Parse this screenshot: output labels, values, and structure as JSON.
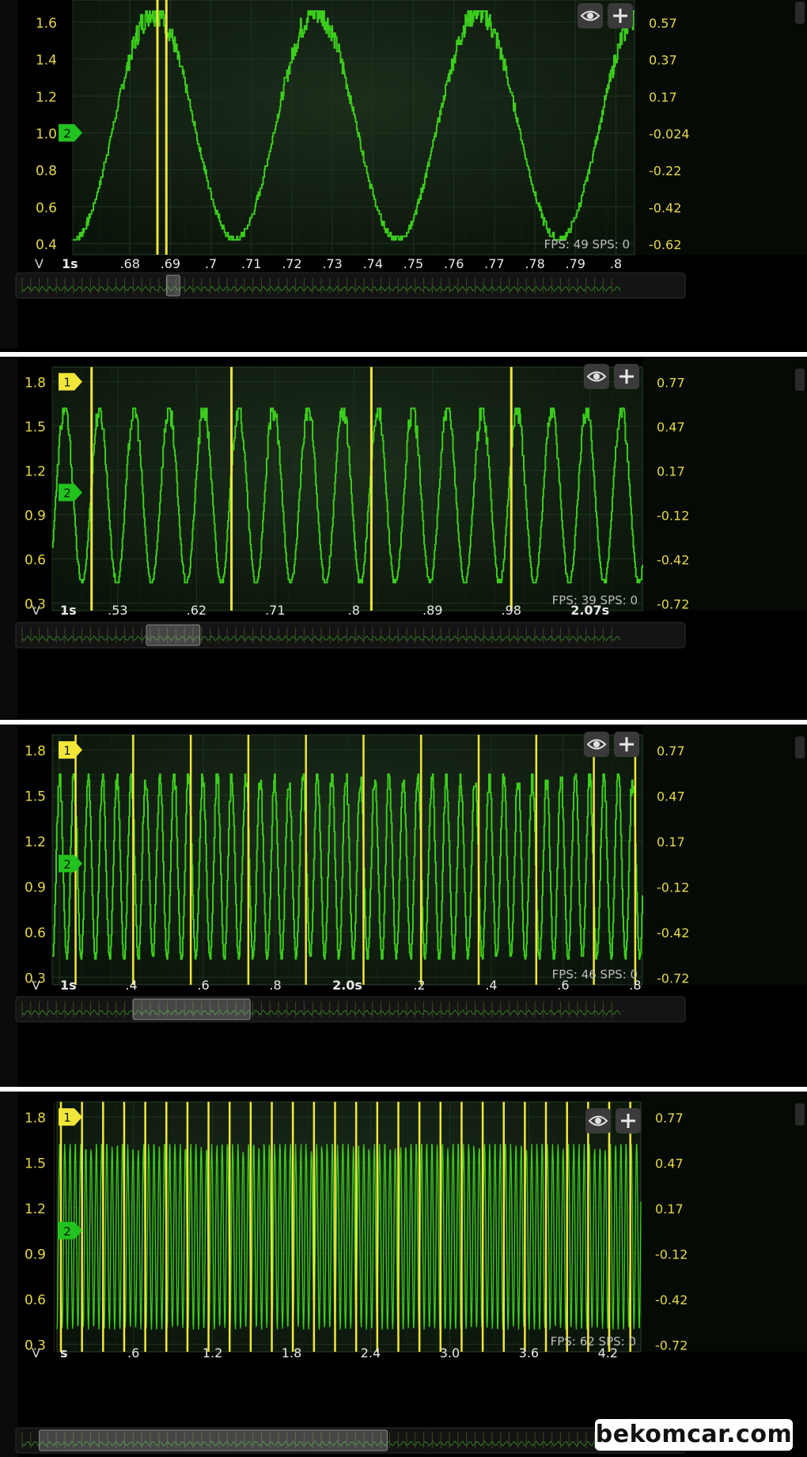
{
  "colors": {
    "trace": "#3ccd1c",
    "cursor": "#f2e63a",
    "label": "#e6d84a",
    "grid": "#1f3320",
    "plot_bg": "#0e1a0e",
    "marker1": "#f2e63a",
    "marker2": "#22c21f"
  },
  "watermark": "bekomcar.com",
  "chart_data": [
    {
      "type": "line",
      "unit_label": "V",
      "x_ticks": [
        {
          "x": 0.6659,
          "label": "1s",
          "bold": true
        },
        {
          "x": 0.68,
          "label": ".68"
        },
        {
          "x": 0.69,
          "label": ".69"
        },
        {
          "x": 0.7,
          "label": ".7"
        },
        {
          "x": 0.71,
          "label": ".71"
        },
        {
          "x": 0.72,
          "label": ".72"
        },
        {
          "x": 0.73,
          "label": ".73"
        },
        {
          "x": 0.74,
          "label": ".74"
        },
        {
          "x": 0.75,
          "label": ".75"
        },
        {
          "x": 0.76,
          "label": ".76"
        },
        {
          "x": 0.77,
          "label": ".77"
        },
        {
          "x": 0.78,
          "label": ".78"
        },
        {
          "x": 0.79,
          "label": ".79"
        },
        {
          "x": 0.8,
          "label": ".8"
        }
      ],
      "xlim": [
        0.6659,
        0.8046
      ],
      "ylim": [
        0.34,
        1.72
      ],
      "y_ticks": [
        0.4,
        0.6,
        0.8,
        1.0,
        1.2,
        1.4,
        1.6
      ],
      "y_tick_labels": [
        "0.4",
        "0.6",
        "0.8",
        "1.0",
        "1.2",
        "1.4",
        "1.6"
      ],
      "y2_tick_labels": [
        "-0.62",
        "-0.42",
        "-0.22",
        "-0.024",
        "0.17",
        "0.37",
        "0.57"
      ],
      "markers": [
        {
          "label": "2",
          "y": 1.0,
          "color": "marker2"
        }
      ],
      "cursors": [
        0.6868,
        0.689
      ],
      "trace": {
        "period": 0.04,
        "phase": 0.6659,
        "min": 0.42,
        "max": 1.66,
        "noise": 0.05,
        "steps": true
      },
      "status": "FPS: 49  SPS: 0",
      "scroll_thumb": [
        0.225,
        0.245
      ]
    },
    {
      "type": "line",
      "unit_label": "V",
      "x_ticks": [
        {
          "x": 0.455,
          "label": "1s",
          "bold": true
        },
        {
          "x": 0.53,
          "label": ".53"
        },
        {
          "x": 0.62,
          "label": ".62"
        },
        {
          "x": 0.71,
          "label": ".71"
        },
        {
          "x": 0.8,
          "label": ".8"
        },
        {
          "x": 0.89,
          "label": ".89"
        },
        {
          "x": 0.98,
          "label": ".98"
        },
        {
          "x": 1.07,
          "label": "2.07s",
          "bold": true
        }
      ],
      "xlim": [
        0.455,
        1.13
      ],
      "ylim": [
        0.25,
        1.9
      ],
      "y_ticks": [
        0.3,
        0.6,
        0.9,
        1.2,
        1.5,
        1.8
      ],
      "y_tick_labels": [
        "0.3",
        "0.6",
        "0.9",
        "1.2",
        "1.5",
        "1.8"
      ],
      "y2_tick_labels": [
        "-0.72",
        "-0.42",
        "-0.12",
        "0.17",
        "0.47",
        "0.77"
      ],
      "markers": [
        {
          "label": "1",
          "y": 1.8,
          "color": "marker1"
        },
        {
          "label": "2",
          "y": 1.05,
          "color": "marker2"
        }
      ],
      "cursors": [
        0.5,
        0.66,
        0.82,
        0.98
      ],
      "trace": {
        "period": 0.0398,
        "phase": 0.449,
        "min": 0.43,
        "max": 1.62,
        "noise": 0.06,
        "steps": true
      },
      "status": "FPS: 39  SPS: 0",
      "scroll_thumb": [
        0.195,
        0.275
      ]
    },
    {
      "type": "line",
      "unit_label": "V",
      "x_ticks": [
        {
          "x": 0.0,
          "label": "1s",
          "bold": true
        },
        {
          "x": 0.2,
          "label": ".4"
        },
        {
          "x": 0.4,
          "label": ".6"
        },
        {
          "x": 0.6,
          "label": ".8"
        },
        {
          "x": 0.8,
          "label": "2.0s",
          "bold": true
        },
        {
          "x": 1.0,
          "label": ".2"
        },
        {
          "x": 1.2,
          "label": ".4"
        },
        {
          "x": 1.4,
          "label": ".6"
        },
        {
          "x": 1.6,
          "label": ".8"
        }
      ],
      "xlim": [
        -0.02,
        1.62
      ],
      "ylim": [
        0.25,
        1.9
      ],
      "y_ticks": [
        0.3,
        0.6,
        0.9,
        1.2,
        1.5,
        1.8
      ],
      "y_tick_labels": [
        "0.3",
        "0.6",
        "0.9",
        "1.2",
        "1.5",
        "1.8"
      ],
      "y2_tick_labels": [
        "-0.72",
        "-0.42",
        "-0.12",
        "0.17",
        "0.47",
        "0.77"
      ],
      "markers": [
        {
          "label": "1",
          "y": 1.8,
          "color": "marker1"
        },
        {
          "label": "2",
          "y": 1.05,
          "color": "marker2"
        }
      ],
      "cursors": [
        0.045,
        0.205,
        0.365,
        0.525,
        0.685,
        0.845,
        1.005,
        1.165,
        1.325,
        1.485,
        1.6
      ],
      "trace": {
        "period": 0.0398,
        "phase": -0.02,
        "min": 0.42,
        "max": 1.63,
        "noise": 0.06,
        "steps": true
      },
      "status": "FPS: 46  SPS: 0",
      "scroll_thumb": [
        0.175,
        0.35
      ]
    },
    {
      "type": "line",
      "unit_label": "V",
      "x_ticks": [
        {
          "x": 0.0,
          "label": "s",
          "bold": true
        },
        {
          "x": 0.6,
          "label": ".6"
        },
        {
          "x": 1.2,
          "label": "1.2"
        },
        {
          "x": 1.8,
          "label": "1.8"
        },
        {
          "x": 2.4,
          "label": "2.4"
        },
        {
          "x": 3.0,
          "label": "3.0"
        },
        {
          "x": 3.6,
          "label": "3.6"
        },
        {
          "x": 4.2,
          "label": "4.2"
        }
      ],
      "xlim": [
        0.02,
        4.45
      ],
      "ylim": [
        0.25,
        1.9
      ],
      "y_ticks": [
        0.3,
        0.6,
        0.9,
        1.2,
        1.5,
        1.8
      ],
      "y_tick_labels": [
        "0.3",
        "0.6",
        "0.9",
        "1.2",
        "1.5",
        "1.8"
      ],
      "y2_tick_labels": [
        "-0.72",
        "-0.42",
        "-0.12",
        "0.17",
        "0.47",
        "0.77"
      ],
      "markers": [
        {
          "label": "1",
          "y": 1.8,
          "color": "marker1"
        },
        {
          "label": "2",
          "y": 1.05,
          "color": "marker2"
        }
      ],
      "cursor_spacing": 0.16,
      "cursor_start": 0.05,
      "trace": {
        "period": 0.0398,
        "phase": 0.02,
        "min": 0.4,
        "max": 1.62,
        "noise": 0.04,
        "steps": false
      },
      "status": "FPS: 62  SPS: 0",
      "scroll_thumb": [
        0.035,
        0.555
      ]
    }
  ]
}
